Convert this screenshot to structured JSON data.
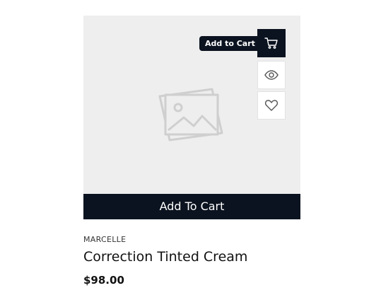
{
  "product": {
    "brand": "MARCELLE",
    "title": "Correction Tinted Cream",
    "price": "$98.00"
  },
  "actions": {
    "cart_tooltip": "Add to Cart",
    "add_to_cart_bar_label": "Add To Cart",
    "icons": [
      "cart-icon",
      "eye-icon",
      "heart-icon"
    ]
  },
  "image": {
    "placeholder_icon": "image-placeholder-icon"
  },
  "colors": {
    "dark": "#0b1320",
    "media_background": "#eeeeee",
    "placeholder_stroke": "#cfcfcf",
    "icon_stroke": "#555555"
  }
}
